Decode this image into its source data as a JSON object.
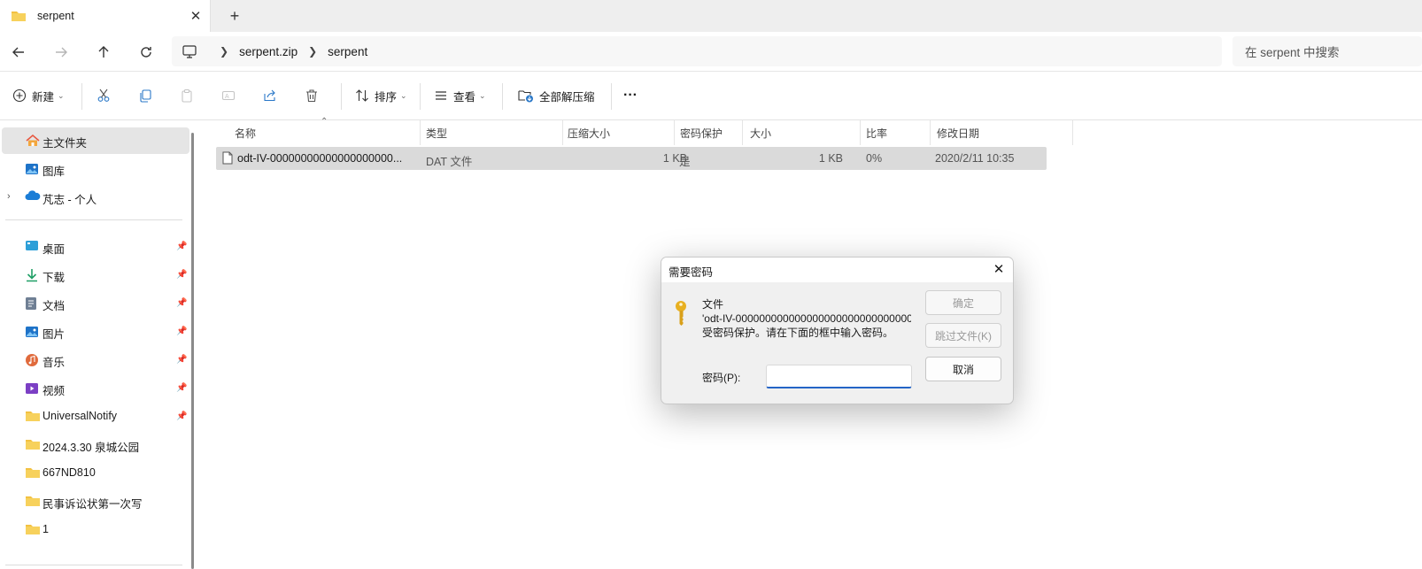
{
  "tab": {
    "title": "serpent",
    "close_glyph": "✕",
    "new_glyph": "+"
  },
  "address": {
    "crumbs": [
      "serpent.zip",
      "serpent"
    ],
    "search_placeholder": "在 serpent 中搜索"
  },
  "toolbar": {
    "new_label": "新建",
    "sort_label": "排序",
    "view_label": "查看",
    "extract_all_label": "全部解压缩",
    "more_glyph": "···"
  },
  "sidebar": {
    "top_items": [
      {
        "label": "主文件夹",
        "icon": "home-icon"
      },
      {
        "label": "图库",
        "icon": "gallery-icon"
      },
      {
        "label": "芃志 - 个人",
        "icon": "onedrive-icon"
      }
    ],
    "quick_items": [
      {
        "label": "桌面",
        "icon": "desktop-icon"
      },
      {
        "label": "下载",
        "icon": "download-icon"
      },
      {
        "label": "文档",
        "icon": "document-icon"
      },
      {
        "label": "图片",
        "icon": "pictures-icon"
      },
      {
        "label": "音乐",
        "icon": "music-icon"
      },
      {
        "label": "视频",
        "icon": "video-icon"
      },
      {
        "label": "UniversalNotify",
        "icon": "folder-icon"
      },
      {
        "label": "2024.3.30 泉城公园",
        "icon": "folder-icon"
      },
      {
        "label": "667ND810",
        "icon": "folder-icon"
      },
      {
        "label": "民事诉讼状第一次写",
        "icon": "folder-icon"
      },
      {
        "label": "1",
        "icon": "folder-icon"
      }
    ]
  },
  "columns": [
    "名称",
    "类型",
    "压缩大小",
    "密码保护",
    "大小",
    "比率",
    "修改日期"
  ],
  "files": [
    {
      "name": "odt-IV-00000000000000000000...",
      "type": "DAT 文件",
      "compressed_size": "1 KB",
      "password_protected": "是",
      "size": "1 KB",
      "ratio": "0%",
      "modified": "2020/2/11 10:35"
    }
  ],
  "dialog": {
    "title": "需要密码",
    "message_line1": "文件",
    "message_line2": "'odt-IV-0000000000000000000000000000000",
    "message_line3": "受密码保护。请在下面的框中输入密码。",
    "ok_label": "确定",
    "skip_label": "跳过文件(K)",
    "cancel_label": "取消",
    "password_label": "密码(P):",
    "password_value": "",
    "close_glyph": "✕"
  },
  "colors": {
    "accent": "#2464c6",
    "folder": "#f3c142",
    "selection": "#dadada"
  }
}
